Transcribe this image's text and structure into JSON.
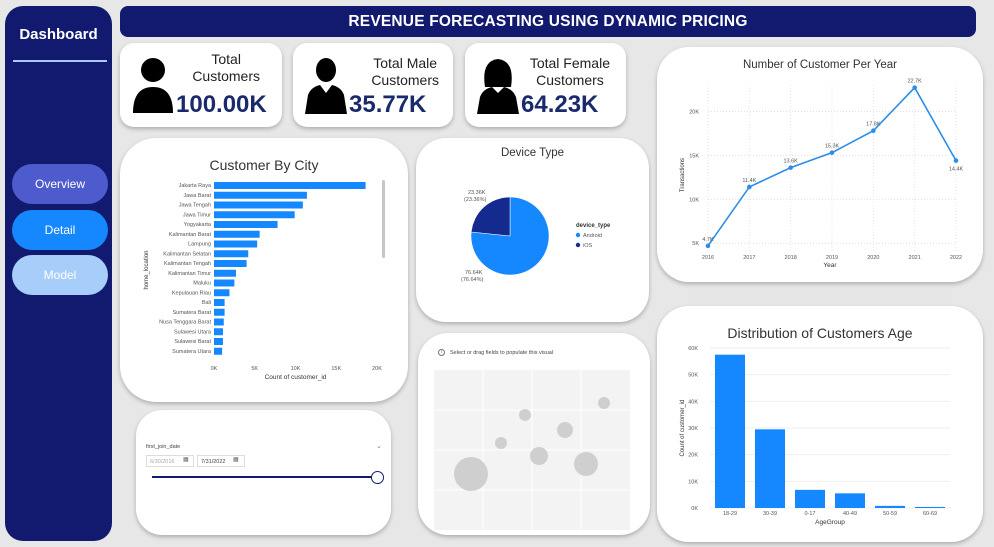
{
  "sidebar": {
    "title": "Dashboard",
    "nav": [
      {
        "label": "Overview",
        "color": "#4e5bcc"
      },
      {
        "label": "Detail",
        "color": "#1688ff"
      },
      {
        "label": "Model",
        "color": "#a7cdfa"
      }
    ]
  },
  "header": {
    "title": "REVENUE FORECASTING USING DYNAMIC PRICING"
  },
  "kpis": [
    {
      "label": "Total\nCustomers",
      "value": "100.00K",
      "icon": "person-icon"
    },
    {
      "label": "Total Male\nCustomers",
      "value": "35.77K",
      "icon": "male-person-icon"
    },
    {
      "label": "Total Female\nCustomers",
      "value": "64.23K",
      "icon": "female-person-icon"
    }
  ],
  "colors": {
    "navy": "#111a6e",
    "bar": "#1688ff",
    "line": "#2b8ee6",
    "android": "#1688ff",
    "ios": "#152a8e"
  },
  "chart_data": [
    {
      "id": "city",
      "type": "bar",
      "orientation": "horizontal",
      "title": "Customer By City",
      "xlabel": "Count of customer_id",
      "ylabel": "home_location",
      "xlim": [
        0,
        20000
      ],
      "xticks": [
        "0K",
        "5K",
        "10K",
        "15K",
        "20K"
      ],
      "categories": [
        "Jakarta Raya",
        "Jawa Barat",
        "Jawa Tengah",
        "Jawa Timur",
        "Yogyakarta",
        "Kalimantan Barat",
        "Lampung",
        "Kalimantan Selatan",
        "Kalimantan Tengah",
        "Kalimantan Timur",
        "Maluku",
        "Kepulauan Riau",
        "Bali",
        "Sumatera Barat",
        "Nusa Tenggara Barat",
        "Sulawesi Utara",
        "Sulawesi Barat",
        "Sumatera Utara"
      ],
      "values": [
        18600,
        11400,
        10900,
        9900,
        7800,
        5600,
        5300,
        4200,
        4000,
        2700,
        2500,
        1900,
        1300,
        1300,
        1200,
        1100,
        1100,
        1000
      ]
    },
    {
      "id": "device",
      "type": "pie",
      "title": "Device Type",
      "legend_title": "device_type",
      "legend_position": "right",
      "slices": [
        {
          "name": "Android",
          "value": 76.64,
          "label": "76.64K",
          "pct": "(76.64%)"
        },
        {
          "name": "iOS",
          "value": 23.36,
          "label": "23.36K",
          "pct": "(23.36%)"
        }
      ]
    },
    {
      "id": "peryear",
      "type": "line",
      "title": "Number of Customer Per Year",
      "xlabel": "Year",
      "ylabel": "Transactions",
      "ylim": [
        4000,
        23000
      ],
      "yticks": [
        5000,
        10000,
        15000,
        20000
      ],
      "ytick_labels": [
        "5K",
        "10K",
        "15K",
        "20K"
      ],
      "x": [
        "2016",
        "2017",
        "2018",
        "2019",
        "2020",
        "2021",
        "2022"
      ],
      "values": [
        4700,
        11400,
        13600,
        15300,
        17800,
        22700,
        14400
      ],
      "data_labels": [
        "4.7K",
        "11.4K",
        "13.6K",
        "15.3K",
        "17.8K",
        "22.7K",
        "14.4K"
      ]
    },
    {
      "id": "age",
      "type": "bar",
      "orientation": "vertical",
      "title": "Distribution of Customers Age",
      "xlabel": "AgeGroup",
      "ylabel": "Count of customer_id",
      "ylim": [
        0,
        60000
      ],
      "yticks": [
        0,
        10000,
        20000,
        30000,
        40000,
        50000,
        60000
      ],
      "ytick_labels": [
        "0K",
        "10K",
        "20K",
        "30K",
        "40K",
        "50K",
        "60K"
      ],
      "categories": [
        "18-29",
        "30-39",
        "0-17",
        "40-49",
        "50-59",
        "60-69"
      ],
      "values": [
        57500,
        29500,
        6800,
        5500,
        800,
        400
      ]
    }
  ],
  "filter": {
    "field": "first_join_date",
    "start": "6/30/2016",
    "end": "7/31/2022"
  },
  "placeholder": {
    "text": "Select or drag fields to populate this visual"
  }
}
